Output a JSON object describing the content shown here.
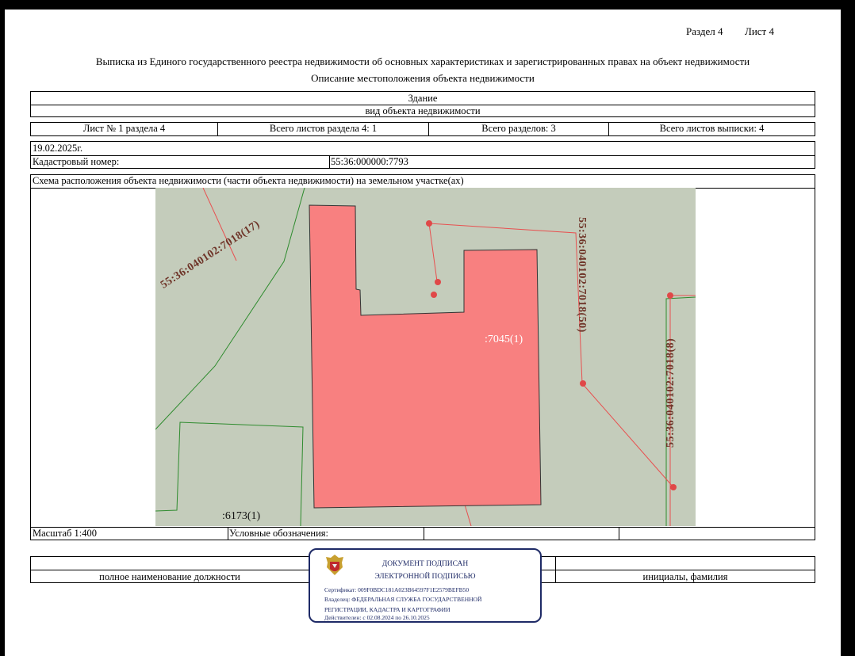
{
  "header": {
    "section": "Раздел 4",
    "sheet": "Лист 4"
  },
  "title_main": "Выписка из Единого государственного реестра недвижимости об основных характеристиках и зарегистрированных правах на объект недвижимости",
  "title_sub": "Описание местоположения объекта недвижимости",
  "object_type": "Здание",
  "object_type_caption": "вид объекта недвижимости",
  "sheet_info": {
    "sheet_no": "Лист № 1 раздела 4",
    "total_sheets_section": "Всего листов раздела 4: 1",
    "total_sections": "Всего разделов: 3",
    "total_sheets": "Всего листов выписки: 4"
  },
  "date": "19.02.2025г.",
  "cadastral": {
    "label": "Кадастровый номер:",
    "value": "55:36:000000:7793"
  },
  "scheme_title": "Схема расположения объекта недвижимости (части объекта недвижимости) на земельном участке(ах)",
  "map_labels": {
    "parcel_17": "55:36:040102:7018(17)",
    "parcel_50": "55:36:040102:7018(50)",
    "parcel_8": "55:36:040102:7018(8)",
    "building": ":7045(1)",
    "parcel_6173": ":6173(1)"
  },
  "colors": {
    "map_bg": "#c4ccbb",
    "building_fill": "#f88080",
    "boundary_red": "#e85050",
    "boundary_green": "#2e8b2e",
    "stamp_blue": "#1e2a66"
  },
  "footer": {
    "scale": "Масштаб 1:400",
    "legend": "Условные обозначения:",
    "position_caption": "полное наименование должности",
    "initials_caption": "инициалы, фамилия"
  },
  "stamp": {
    "line1": "ДОКУМЕНТ ПОДПИСАН",
    "line2": "ЭЛЕКТРОННОЙ ПОДПИСЬЮ",
    "certificate": "Сертификат: 009F0BDC181A023B64597F1E2579BEFB50",
    "owner1": "Владелец: ФЕДЕРАЛЬНАЯ СЛУЖБА ГОСУДАРСТВЕННОЙ",
    "owner2": "РЕГИСТРАЦИИ, КАДАСТРА И КАРТОГРАФИИ",
    "valid": "Действителен: с 02.08.2024 по 26.10.2025"
  }
}
